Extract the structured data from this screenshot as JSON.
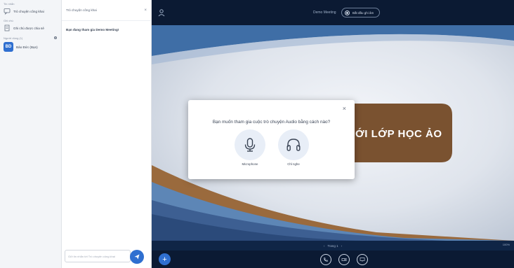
{
  "sidebar": {
    "messages_section": "Tin nhắn",
    "public_chat_label": "Trò chuyện công khai",
    "notes_section": "Ghi chú",
    "shared_notes_label": "Ghi chú được chia sẻ",
    "users_section": "Người dùng (1)",
    "user": {
      "initials": "BD",
      "name": "Bảo Đức (Bạn)"
    }
  },
  "chat": {
    "header_title": "Trò chuyện công khai",
    "close_glyph": "×",
    "welcome": "Bạn đang tham gia Demo Meeting!",
    "input_placeholder": "Gửi tin nhắn tới Trò chuyện công khai"
  },
  "topbar": {
    "meeting_title": "Demo Meeting",
    "record_label": "Bắt đầu ghi âm"
  },
  "slide": {
    "banner_text": "ỚI LỚP HỌC ẢO",
    "colors": {
      "banner": "#7a5230",
      "banner_text": "#ffffff"
    }
  },
  "slidebar": {
    "prev": "‹",
    "page_label": "Trang 1",
    "next": "›",
    "zoom": "100%"
  },
  "modal": {
    "close_glyph": "×",
    "question": "Bạn muốn tham gia cuộc trò chuyện Audio bằng cách nào?",
    "options": [
      {
        "icon": "microphone-icon",
        "label": "Microphone"
      },
      {
        "icon": "headphones-icon",
        "label": "Chỉ nghe"
      }
    ]
  },
  "colors": {
    "accent": "#2f6fd0",
    "dark_bg": "#0b1a33",
    "option_bg": "#e8eef7"
  }
}
